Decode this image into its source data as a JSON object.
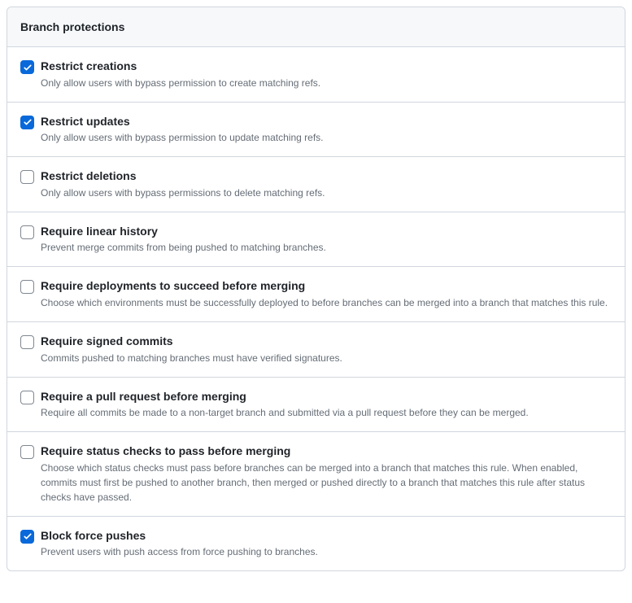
{
  "panel": {
    "title": "Branch protections"
  },
  "rules": [
    {
      "checked": true,
      "title": "Restrict creations",
      "desc": "Only allow users with bypass permission to create matching refs."
    },
    {
      "checked": true,
      "title": "Restrict updates",
      "desc": "Only allow users with bypass permission to update matching refs."
    },
    {
      "checked": false,
      "title": "Restrict deletions",
      "desc": "Only allow users with bypass permissions to delete matching refs."
    },
    {
      "checked": false,
      "title": "Require linear history",
      "desc": "Prevent merge commits from being pushed to matching branches."
    },
    {
      "checked": false,
      "title": "Require deployments to succeed before merging",
      "desc": "Choose which environments must be successfully deployed to before branches can be merged into a branch that matches this rule."
    },
    {
      "checked": false,
      "title": "Require signed commits",
      "desc": "Commits pushed to matching branches must have verified signatures."
    },
    {
      "checked": false,
      "title": "Require a pull request before merging",
      "desc": "Require all commits be made to a non-target branch and submitted via a pull request before they can be merged."
    },
    {
      "checked": false,
      "title": "Require status checks to pass before merging",
      "desc": "Choose which status checks must pass before branches can be merged into a branch that matches this rule. When enabled, commits must first be pushed to another branch, then merged or pushed directly to a branch that matches this rule after status checks have passed."
    },
    {
      "checked": true,
      "title": "Block force pushes",
      "desc": "Prevent users with push access from force pushing to branches."
    }
  ]
}
